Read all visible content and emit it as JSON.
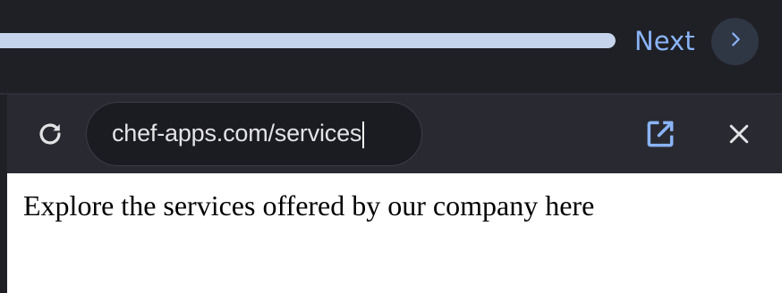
{
  "progress": {
    "value_percent": 100,
    "fill_color": "#c6d4eb"
  },
  "next": {
    "label": "Next",
    "icon": "chevron-right-icon",
    "color": "#8ab4f8"
  },
  "toolbar": {
    "reload_icon": "reload-icon",
    "url": "chef-apps.com/services",
    "open_in_new_icon": "open-in-new-icon",
    "close_icon": "close-icon"
  },
  "page": {
    "text": "Explore the services offered by our company here"
  }
}
